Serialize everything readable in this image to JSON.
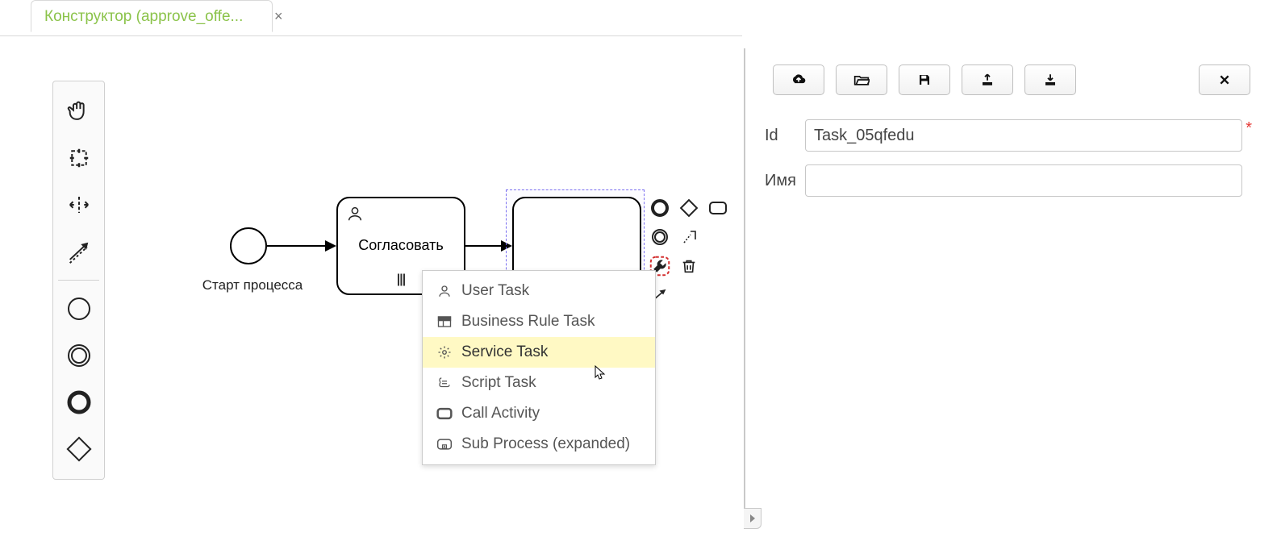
{
  "tab": {
    "title": "Конструктор (approve_offe..."
  },
  "canvas": {
    "start_label": "Старт процесса",
    "task_user_label": "Согласовать"
  },
  "context_menu": {
    "items": [
      {
        "key": "user",
        "label": "User Task"
      },
      {
        "key": "business",
        "label": "Business Rule Task"
      },
      {
        "key": "service",
        "label": "Service Task"
      },
      {
        "key": "script",
        "label": "Script Task"
      },
      {
        "key": "call",
        "label": "Call Activity"
      },
      {
        "key": "sub",
        "label": "Sub Process (expanded)"
      }
    ],
    "hovered_key": "service"
  },
  "properties": {
    "fields": {
      "id": {
        "label": "Id",
        "value": "Task_05qfedu",
        "required": true
      },
      "name": {
        "label": "Имя",
        "value": "",
        "required": false
      }
    }
  },
  "palette_icons": [
    "hand",
    "lasso",
    "space",
    "connect",
    "start-event",
    "intermediate-event",
    "end-event",
    "gateway"
  ],
  "context_pad_icons": [
    "end-event",
    "gateway",
    "task",
    "intermediate-event",
    "annotation",
    "wrench",
    "trash",
    "sequence-flow"
  ]
}
